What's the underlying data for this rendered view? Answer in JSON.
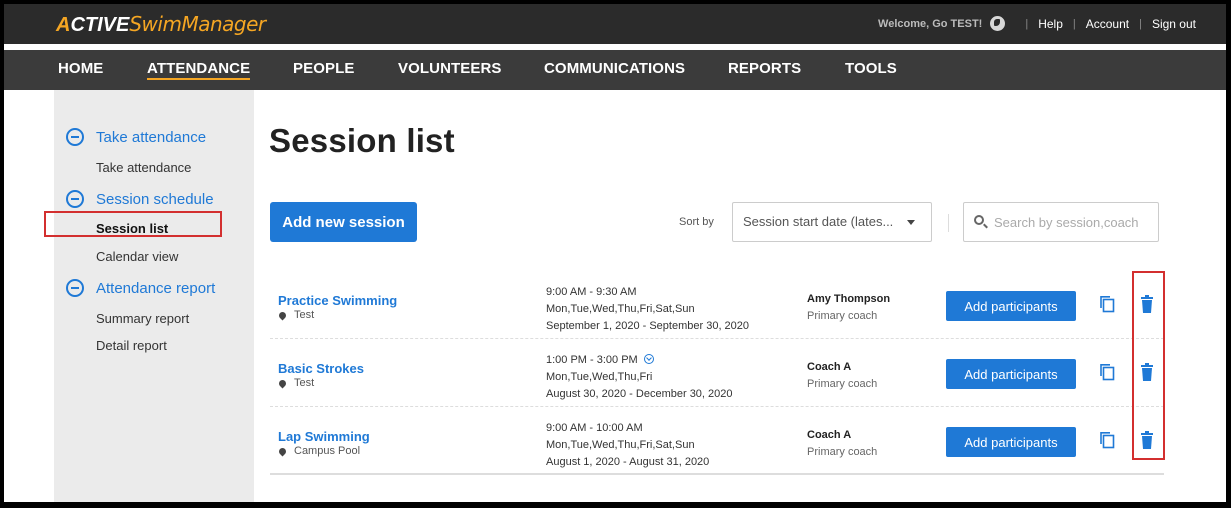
{
  "brand": {
    "part1": "CTIVE",
    "letter": "A",
    "part2": "SwimManager"
  },
  "topbar": {
    "welcome": "Welcome, Go TEST!",
    "help": "Help",
    "account": "Account",
    "signout": "Sign out"
  },
  "nav": [
    "HOME",
    "ATTENDANCE",
    "PEOPLE",
    "VOLUNTEERS",
    "COMMUNICATIONS",
    "REPORTS",
    "TOOLS"
  ],
  "sidebar": {
    "take_attendance_title": "Take attendance",
    "take_attendance_link": "Take attendance",
    "session_schedule_title": "Session schedule",
    "session_list_link": "Session list",
    "calendar_view_link": "Calendar view",
    "attendance_report_title": "Attendance report",
    "summary_report_link": "Summary report",
    "detail_report_link": "Detail report"
  },
  "main": {
    "title": "Session list",
    "add_button": "Add new session",
    "sort_label": "Sort by",
    "sort_value": "Session start date (lates...",
    "search_placeholder": "Search by session,coach"
  },
  "sessions": [
    {
      "name": "Practice Swimming",
      "location": "Test",
      "time": "9:00 AM - 9:30 AM",
      "days": "Mon,Tue,Wed,Thu,Fri,Sat,Sun",
      "dates": "September 1, 2020 - September 30, 2020",
      "coach": "Amy Thompson",
      "role": "Primary coach",
      "button": "Add participants"
    },
    {
      "name": "Basic Strokes",
      "location": "Test",
      "time": "1:00 PM - 3:00 PM",
      "days": "Mon,Tue,Wed,Thu,Fri",
      "dates": "August 30, 2020 - December 30, 2020",
      "coach": "Coach A",
      "role": "Primary coach",
      "button": "Add participants"
    },
    {
      "name": "Lap Swimming",
      "location": "Campus Pool",
      "time": "9:00 AM - 10:00 AM",
      "days": "Mon,Tue,Wed,Thu,Fri,Sat,Sun",
      "dates": "August 1, 2020 - August 31, 2020",
      "coach": "Coach A",
      "role": "Primary coach",
      "button": "Add participants"
    }
  ],
  "colors": {
    "accent": "#1f79d6",
    "brand": "#f5a623",
    "highlight": "#d32f2f"
  }
}
